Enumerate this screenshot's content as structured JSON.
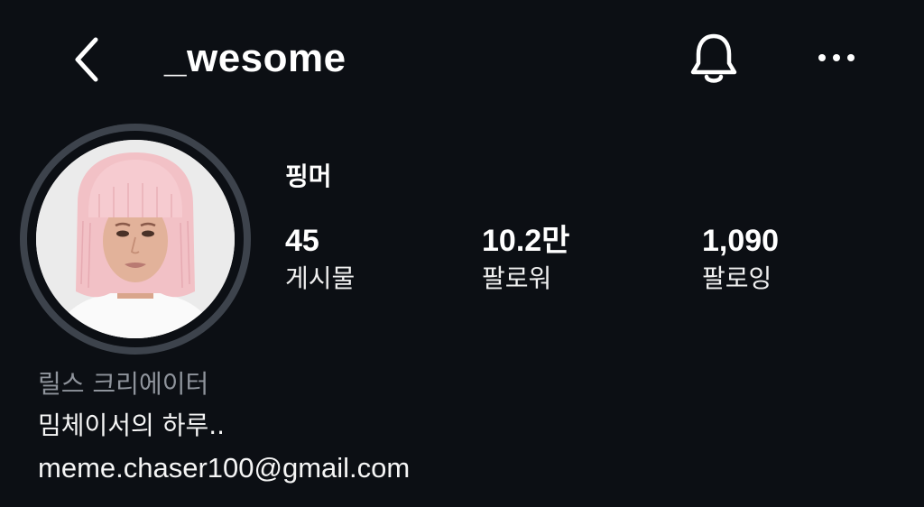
{
  "header": {
    "back_icon": "chevron-left-icon",
    "username": "_wesome",
    "bell_icon": "bell-icon",
    "more_icon": "more-horizontal-icon"
  },
  "profile": {
    "display_name": "핑머",
    "stats": {
      "posts": {
        "value": "45",
        "label": "게시물"
      },
      "followers": {
        "value": "10.2만",
        "label": "팔로워"
      },
      "following": {
        "value": "1,090",
        "label": "팔로잉"
      }
    },
    "bio": {
      "category": "릴스 크리에이터",
      "text": "밈체이서의 하루..",
      "email": "meme.chaser100@gmail.com"
    }
  },
  "colors": {
    "background": "#0c0f14",
    "text": "#ffffff",
    "category": "#8f949c",
    "ring": "#3d434c",
    "hair": "#f3c4c8"
  }
}
